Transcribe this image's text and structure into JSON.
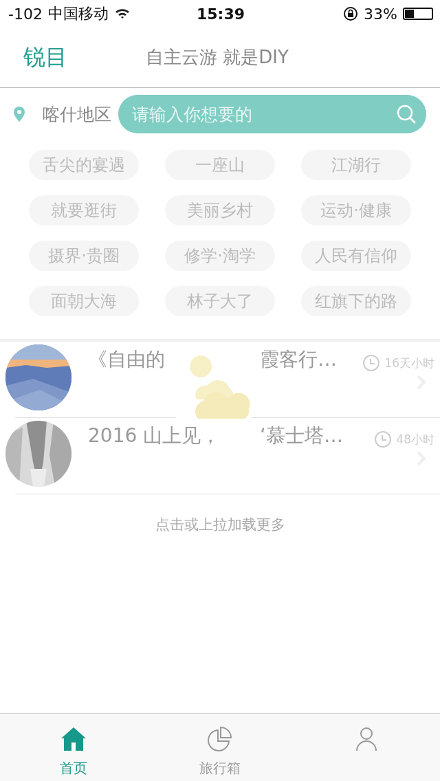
{
  "status_bar": {
    "signal": "-102",
    "carrier": "中国移动",
    "time": "15:39",
    "battery": "33%"
  },
  "header": {
    "logo": "锐目",
    "slogan": "自主云游 就是DIY"
  },
  "search": {
    "location": "喀什地区",
    "placeholder": "请输入你想要的"
  },
  "tags": [
    "舌尖的宴遇",
    "一座山",
    "江湖行",
    "就要逛街",
    "美丽乡村",
    "运动·健康",
    "摄界·贵圈",
    "修学·淘学",
    "人民有信仰",
    "面朝大海",
    "林子大了",
    "红旗下的路"
  ],
  "posts": [
    {
      "title_parts": [
        "《自由的",
        "霞客行…"
      ],
      "time": "16天小时"
    },
    {
      "title_parts": [
        "2016 山上见，",
        "‘慕士塔…"
      ],
      "time": "48小时"
    }
  ],
  "load_more": "点击或上拉加载更多",
  "tab_bar": [
    {
      "label": "首页",
      "selected": true
    },
    {
      "label": "旅行箱",
      "selected": false
    },
    {
      "selected": false
    }
  ]
}
